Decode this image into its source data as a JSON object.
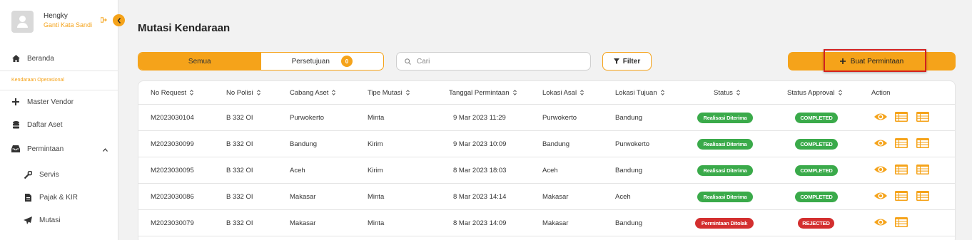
{
  "sidebar": {
    "user_name": "Hengky",
    "change_password": "Ganti Kata Sandi",
    "home": "Beranda",
    "section": "Kendaraan Operasional",
    "items": [
      {
        "label": "Master Vendor"
      },
      {
        "label": "Daftar Aset"
      },
      {
        "label": "Permintaan"
      }
    ],
    "subitems": [
      {
        "label": "Servis"
      },
      {
        "label": "Pajak & KIR"
      },
      {
        "label": "Mutasi"
      }
    ]
  },
  "main": {
    "title": "Mutasi Kendaraan",
    "tabs": [
      {
        "label": "Semua"
      },
      {
        "label": "Persetujuan",
        "badge": "0"
      }
    ],
    "search_placeholder": "Cari",
    "filter_label": "Filter",
    "create_label": "Buat Permintaan"
  },
  "table": {
    "columns": [
      "No Request",
      "No Polisi",
      "Cabang Aset",
      "Tipe Mutasi",
      "Tanggal Permintaan",
      "Lokasi Asal",
      "Lokasi Tujuan",
      "Status",
      "Status Approval",
      "Action"
    ],
    "rows": [
      {
        "no_request": "M2023030104",
        "no_polisi": "B 332 OI",
        "cabang": "Purwokerto",
        "tipe": "Minta",
        "tanggal": "9 Mar 2023 11:29",
        "asal": "Purwokerto",
        "tujuan": "Bandung",
        "status": "Realisasi Diterima",
        "approval": "COMPLETED"
      },
      {
        "no_request": "M2023030099",
        "no_polisi": "B 332 OI",
        "cabang": "Bandung",
        "tipe": "Kirim",
        "tanggal": "9 Mar 2023 10:09",
        "asal": "Bandung",
        "tujuan": "Purwokerto",
        "status": "Realisasi Diterima",
        "approval": "COMPLETED"
      },
      {
        "no_request": "M2023030095",
        "no_polisi": "B 332 OI",
        "cabang": "Aceh",
        "tipe": "Kirim",
        "tanggal": "8 Mar 2023 18:03",
        "asal": "Aceh",
        "tujuan": "Bandung",
        "status": "Realisasi Diterima",
        "approval": "COMPLETED"
      },
      {
        "no_request": "M2023030086",
        "no_polisi": "B 332 OI",
        "cabang": "Makasar",
        "tipe": "Minta",
        "tanggal": "8 Mar 2023 14:14",
        "asal": "Makasar",
        "tujuan": "Aceh",
        "status": "Realisasi Diterima",
        "approval": "COMPLETED"
      },
      {
        "no_request": "M2023030079",
        "no_polisi": "B 332 OI",
        "cabang": "Makasar",
        "tipe": "Minta",
        "tanggal": "8 Mar 2023 14:09",
        "asal": "Makasar",
        "tujuan": "Bandung",
        "status": "Permintaan Ditolak",
        "approval": "REJECTED"
      }
    ]
  },
  "colors": {
    "accent": "#f5a31a",
    "success": "#3aaa4a",
    "danger": "#d32f2f"
  }
}
